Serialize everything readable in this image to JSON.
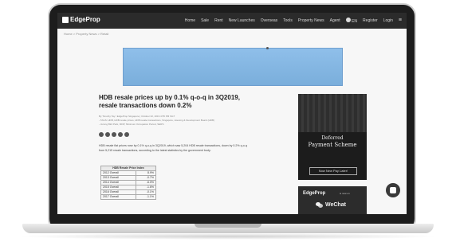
{
  "logo": {
    "text": "EdgeProp"
  },
  "nav": {
    "items": [
      "Home",
      "Sale",
      "Rent",
      "New Launches",
      "Overseas",
      "Tools",
      "Property News",
      "Agent",
      "EN",
      "Register",
      "Login"
    ]
  },
  "breadcrumb": "Home > Property News > Retail",
  "article": {
    "title": "HDB resale prices up by 0.1% q-o-q in 3Q2019, resale transactions down 0.2%",
    "meta_lines": [
      "By Timothy Tay / EdgeProp Singapore | October 02, 2019 4:55 PM SGT",
      "- TAGS: HDB, HDB resale prices, HDB resale transactions, Singapore, Housing & Development Board (HDB)",
      "- Jurong Bird Park, MOP, Minimum Occupation Period, SERS"
    ],
    "lead": "HDB resale flat prices rose by 0.1% q-o-q in 3Q2019, which saw 5,204 HDB resale transactions, down by 0.2% q-o-q from 5,215 resale transactions, according to the latest statistics by the government body."
  },
  "table": {
    "header": "HDB Resale Price Index",
    "rows": [
      {
        "label": "2012 Overall",
        "value": "8.9%"
      },
      {
        "label": "2013 Overall",
        "value": "-0.7%"
      },
      {
        "label": "2014 Overall",
        "value": "-6.0%"
      },
      {
        "label": "2015 Overall",
        "value": "-1.6%"
      },
      {
        "label": "2016 Overall",
        "value": "-0.1%"
      },
      {
        "label": "2017 Overall",
        "value": "-1.1%"
      }
    ]
  },
  "side_ad_1": {
    "line1": "Deferred",
    "line2": "Payment Scheme",
    "cta": "Now New Pay Later!"
  },
  "side_ad_2": {
    "brand": "EdgeProp",
    "small": "is now on",
    "wechat": "WeChat"
  }
}
